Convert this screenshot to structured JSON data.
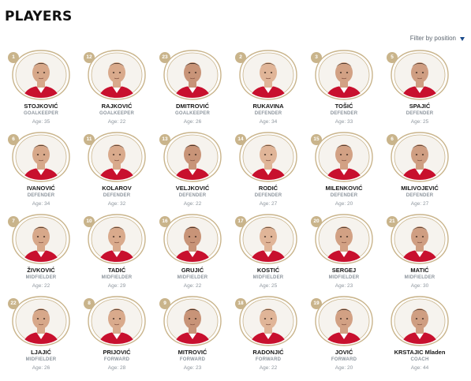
{
  "page": {
    "title": "PLAYERS",
    "filter_label": "Filter by position",
    "age_prefix": "Age:"
  },
  "colors": {
    "frame_gold": "#c9b48b",
    "name_text": "#161616",
    "position_text": "#8e969e",
    "filter_arrow": "#1a4a8a"
  },
  "players": [
    {
      "number": "1",
      "name": "STOJKOVIĆ",
      "position": "GOALKEEPER",
      "age": "35"
    },
    {
      "number": "12",
      "name": "RAJKOVIĆ",
      "position": "GOALKEEPER",
      "age": "22"
    },
    {
      "number": "23",
      "name": "DMITROVIĆ",
      "position": "GOALKEEPER",
      "age": "26"
    },
    {
      "number": "2",
      "name": "RUKAVINA",
      "position": "DEFENDER",
      "age": "34"
    },
    {
      "number": "3",
      "name": "TOŠIĆ",
      "position": "DEFENDER",
      "age": "33"
    },
    {
      "number": "5",
      "name": "SPAJIĆ",
      "position": "DEFENDER",
      "age": "25"
    },
    {
      "number": "6",
      "name": "IVANOVIĆ",
      "position": "DEFENDER",
      "age": "34"
    },
    {
      "number": "11",
      "name": "KOLAROV",
      "position": "DEFENDER",
      "age": "32"
    },
    {
      "number": "13",
      "name": "VELJKOVIĆ",
      "position": "DEFENDER",
      "age": "22"
    },
    {
      "number": "14",
      "name": "RODIĆ",
      "position": "DEFENDER",
      "age": "27"
    },
    {
      "number": "15",
      "name": "MILENKOVIĆ",
      "position": "DEFENDER",
      "age": "20"
    },
    {
      "number": "6",
      "name": "MILIVOJEVIĆ",
      "position": "DEFENDER",
      "age": "27"
    },
    {
      "number": "7",
      "name": "ŽIVKOVIĆ",
      "position": "MIDFIELDER",
      "age": "22"
    },
    {
      "number": "10",
      "name": "TADIĆ",
      "position": "MIDFIELDER",
      "age": "29"
    },
    {
      "number": "16",
      "name": "GRUJIĆ",
      "position": "MIDFIELDER",
      "age": "22"
    },
    {
      "number": "17",
      "name": "KOSTIĆ",
      "position": "MIDFIELDER",
      "age": "25"
    },
    {
      "number": "20",
      "name": "SERGEJ",
      "position": "MIDFIELDER",
      "age": "23"
    },
    {
      "number": "21",
      "name": "MATIĆ",
      "position": "MIDFIELDER",
      "age": "30"
    },
    {
      "number": "22",
      "name": "LJAJIĆ",
      "position": "MIDFIELDER",
      "age": "26"
    },
    {
      "number": "8",
      "name": "PRIJOVIĆ",
      "position": "FORWARD",
      "age": "28"
    },
    {
      "number": "9",
      "name": "MITROVIĆ",
      "position": "FORWARD",
      "age": "23"
    },
    {
      "number": "18",
      "name": "RADONJIĆ",
      "position": "FORWARD",
      "age": "22"
    },
    {
      "number": "19",
      "name": "JOVIĆ",
      "position": "FORWARD",
      "age": "20"
    },
    {
      "number": "",
      "name": "KRSTAJIC Mladen",
      "position": "COACH",
      "age": "44"
    }
  ]
}
